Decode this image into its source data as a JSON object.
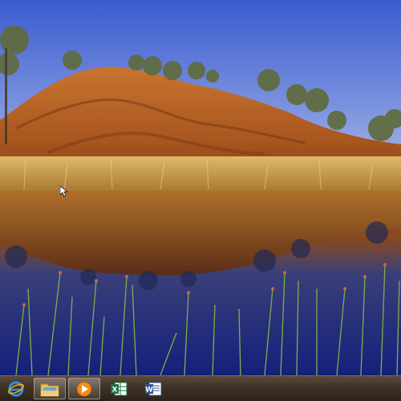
{
  "desktop": {
    "wallpaper": "outback-hill-reflection-landscape",
    "colors": {
      "sky_top": "#3b5bd0",
      "sky_bottom": "#a9b8e8",
      "hill": "#b8662a",
      "water": "#1e2f8a",
      "grass": "#c9a255"
    }
  },
  "taskbar": {
    "items": [
      {
        "icon": "internet-explorer-icon",
        "pinned": true,
        "active": false
      },
      {
        "icon": "file-explorer-icon",
        "pinned": true,
        "active": true
      },
      {
        "icon": "media-player-icon",
        "pinned": true,
        "active": true
      },
      {
        "icon": "excel-icon",
        "pinned": true,
        "active": false
      },
      {
        "icon": "word-icon",
        "pinned": true,
        "active": false
      }
    ]
  }
}
